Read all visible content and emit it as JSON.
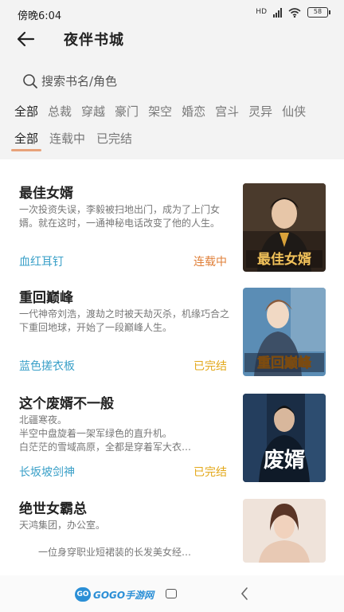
{
  "status_bar": {
    "time": "傍晚6:04",
    "signal": "HD",
    "battery": "58"
  },
  "header": {
    "title": "夜伴书城"
  },
  "search": {
    "placeholder": "搜索书名/角色"
  },
  "category_tabs": [
    {
      "label": "全部",
      "active": true
    },
    {
      "label": "总裁",
      "active": false
    },
    {
      "label": "穿越",
      "active": false
    },
    {
      "label": "豪门",
      "active": false
    },
    {
      "label": "架空",
      "active": false
    },
    {
      "label": "婚恋",
      "active": false
    },
    {
      "label": "宫斗",
      "active": false
    },
    {
      "label": "灵异",
      "active": false
    },
    {
      "label": "仙侠",
      "active": false
    }
  ],
  "status_tabs": [
    {
      "label": "全部",
      "active": true
    },
    {
      "label": "连载中",
      "active": false
    },
    {
      "label": "已完结",
      "active": false
    }
  ],
  "books": [
    {
      "title": "最佳女婿",
      "description": "一次投资失误，李毅被扫地出门，成为了上门女婿。就在这时，一通神秘电话改变了他的人生。",
      "author": "血红耳钉",
      "status": "连载中",
      "status_type": "ongoing",
      "cover_text": "最佳女婿",
      "cover_colors": {
        "bg": "#3a2b20",
        "accent": "#d9a23a"
      }
    },
    {
      "title": "重回巅峰",
      "description": "一代神帝刘浩，渡劫之时被天劫灭杀，机缘巧合之下重回地球，开始了一段巅峰人生。",
      "author": "蓝色搓衣板",
      "status": "已完结",
      "status_type": "done",
      "cover_text": "重回巅峰",
      "cover_colors": {
        "bg": "#4a7fa8",
        "accent": "#f2d55a"
      }
    },
    {
      "title": "这个废婿不一般",
      "description": "北疆寒夜。\n半空中盘旋着一架军绿色的直升机。\n白茫茫的雪域高原，全都是穿着军大衣…",
      "author": "长坂坡剑神",
      "status": "已完结",
      "status_type": "done",
      "cover_text": "废婿",
      "cover_colors": {
        "bg": "#1f3550",
        "accent": "#ffffff"
      }
    },
    {
      "title": "绝世女霸总",
      "description": "天鸿集团，办公室。\n\n　　一位身穿职业短裙装的长发美女经…",
      "author": "",
      "status": "",
      "status_type": "",
      "cover_text": "",
      "cover_colors": {
        "bg": "#e8d7cc",
        "accent": "#6b3f2e"
      }
    }
  ],
  "nav_bar": {
    "logo_badge": "GO",
    "logo_text": "GOGO手游网"
  },
  "colors": {
    "accent_underline": "#e8a27a",
    "author": "#3aa0c8",
    "ongoing": "#e0803a",
    "done": "#e3a81a"
  }
}
